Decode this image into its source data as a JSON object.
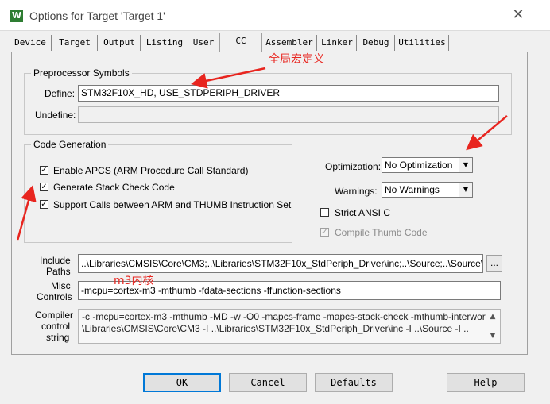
{
  "window": {
    "title": "Options for Target 'Target 1'",
    "app_icon_glyph": "W",
    "close_glyph": "✕"
  },
  "tabs": [
    "Device",
    "Target",
    "Output",
    "Listing",
    "User",
    "CC",
    "Assembler",
    "Linker",
    "Debug",
    "Utilities"
  ],
  "active_tab": "CC",
  "preprocessor": {
    "title": "Preprocessor Symbols",
    "define_label": "Define:",
    "define_value": "STM32F10X_HD, USE_STDPERIPH_DRIVER",
    "undefine_label": "Undefine:",
    "undefine_value": ""
  },
  "code_generation": {
    "title": "Code Generation",
    "options": [
      {
        "label": "Enable APCS (ARM Procedure Call Standard)",
        "checked": true
      },
      {
        "label": "Generate Stack Check Code",
        "checked": true
      },
      {
        "label": "Support Calls between ARM and THUMB Instruction Set",
        "checked": true
      }
    ]
  },
  "optimization": {
    "label": "Optimization:",
    "value": "No Optimization"
  },
  "warnings": {
    "label": "Warnings:",
    "value": "No Warnings"
  },
  "strict_ansi": {
    "label": "Strict ANSI C",
    "checked": false
  },
  "compile_thumb": {
    "label": "Compile Thumb Code",
    "checked": true,
    "disabled": true
  },
  "include_paths": {
    "label_line1": "Include",
    "label_line2": "Paths",
    "value": "..\\Libraries\\CMSIS\\Core\\CM3;..\\Libraries\\STM32F10x_StdPeriph_Driver\\inc;..\\Source;..\\Source\\Ap",
    "browse_label": "..."
  },
  "misc_controls": {
    "label_line1": "Misc",
    "label_line2": "Controls",
    "value": "-mcpu=cortex-m3 -mthumb -fdata-sections -ffunction-sections"
  },
  "compiler_string": {
    "label_line1": "Compiler",
    "label_line2": "control",
    "label_line3": "string",
    "line1": "-c -mcpu=cortex-m3 -mthumb -MD -w -O0 -mapcs-frame -mapcs-stack-check -mthumb-interwork -I ..",
    "line2": "\\Libraries\\CMSIS\\Core\\CM3 -I ..\\Libraries\\STM32F10x_StdPeriph_Driver\\inc -I ..\\Source -I ..",
    "scroll_up": "▲",
    "scroll_down": "▼"
  },
  "buttons": {
    "ok": "OK",
    "cancel": "Cancel",
    "defaults": "Defaults",
    "help": "Help"
  },
  "annotations": {
    "global_macro": "全局宏定义",
    "m3_core": "m3内核",
    "color": "#e8251f"
  }
}
